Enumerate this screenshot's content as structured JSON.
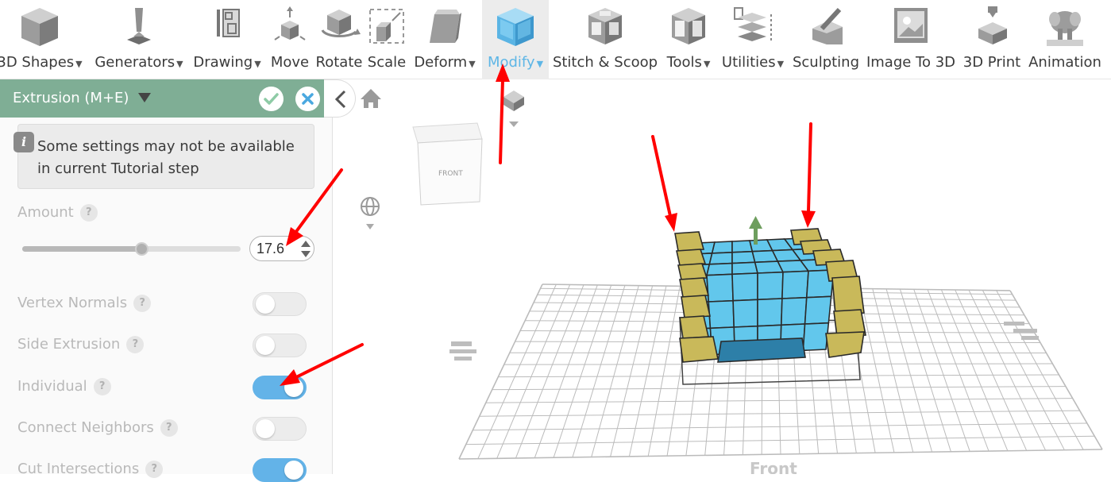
{
  "toolbar": {
    "items": [
      {
        "label": "3D Shapes",
        "dropdown": true,
        "icon": "cube-icon"
      },
      {
        "label": "Generators",
        "dropdown": true,
        "icon": "generators-icon"
      },
      {
        "label": "Drawing",
        "dropdown": true,
        "icon": "drawing-pencil-icon"
      },
      {
        "label": "Move",
        "dropdown": false,
        "icon": "move-icon"
      },
      {
        "label": "Rotate",
        "dropdown": false,
        "icon": "rotate-icon"
      },
      {
        "label": "Scale",
        "dropdown": false,
        "icon": "scale-icon"
      },
      {
        "label": "Deform",
        "dropdown": true,
        "icon": "deform-icon"
      },
      {
        "label": "Modify",
        "dropdown": true,
        "icon": "modify-icon",
        "active": true
      },
      {
        "label": "Stitch & Scoop",
        "dropdown": false,
        "icon": "stitch-scoop-icon"
      },
      {
        "label": "Tools",
        "dropdown": true,
        "icon": "tools-icon"
      },
      {
        "label": "Utilities",
        "dropdown": true,
        "icon": "utilities-icon"
      },
      {
        "label": "Sculpting",
        "dropdown": false,
        "icon": "sculpting-icon"
      },
      {
        "label": "Image To 3D",
        "dropdown": false,
        "icon": "image-to-3d-icon"
      },
      {
        "label": "3D Print",
        "dropdown": false,
        "icon": "3d-print-icon"
      },
      {
        "label": "Animation",
        "dropdown": false,
        "icon": "animation-icon"
      }
    ]
  },
  "panel": {
    "title": "Extrusion (M+E)",
    "notice": "Some settings may not be available in current Tutorial step",
    "amount_label": "Amount",
    "amount_value": "17.6",
    "amount_fraction": 0.55,
    "options": [
      {
        "label": "Vertex Normals",
        "on": false
      },
      {
        "label": "Side Extrusion",
        "on": false
      },
      {
        "label": "Individual",
        "on": true
      },
      {
        "label": "Connect Neighbors",
        "on": false
      },
      {
        "label": "Cut Intersections",
        "on": true
      }
    ]
  },
  "viewport": {
    "view_cube_face": "FRONT",
    "floor_labels": [
      "Front"
    ]
  },
  "colors": {
    "panel_header": "#7fae95",
    "accent_blue": "#5eb6e6",
    "model_blue": "#62c7ec",
    "extruded_faces": "#c9b95a",
    "annotation_red": "#ff0000"
  }
}
